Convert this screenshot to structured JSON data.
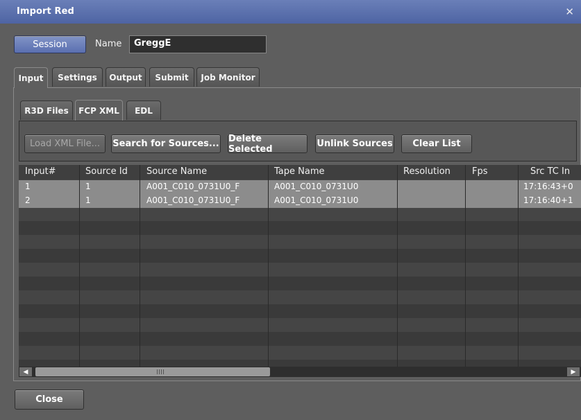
{
  "window": {
    "title": "Import Red",
    "close_glyph": "✕"
  },
  "session": {
    "button_label": "Session",
    "name_label": "Name",
    "name_value": "GreggE"
  },
  "tabs": [
    {
      "label": "Input",
      "active": true
    },
    {
      "label": "Settings",
      "active": false
    },
    {
      "label": "Output",
      "active": false
    },
    {
      "label": "Submit",
      "active": false
    },
    {
      "label": "Job Monitor",
      "active": false
    }
  ],
  "subtabs": [
    {
      "label": "R3D Files",
      "active": false
    },
    {
      "label": "FCP XML",
      "active": true
    },
    {
      "label": "EDL",
      "active": false
    }
  ],
  "toolbar": {
    "load_xml": "Load XML File...",
    "search_sources": "Search for Sources...",
    "delete_selected": "Delete Selected",
    "unlink_sources": "Unlink Sources",
    "clear_list": "Clear List"
  },
  "table": {
    "columns": [
      "Input#",
      "Source Id",
      "Source Name",
      "Tape Name",
      "Resolution",
      "Fps",
      "Src TC In"
    ],
    "rows": [
      [
        "1",
        "1",
        "A001_C010_0731U0_F",
        "A001_C010_0731U0",
        "",
        "",
        "17:16:43+0"
      ],
      [
        "2",
        "1",
        "A001_C010_0731U0_F",
        "A001_C010_0731U0",
        "",
        "",
        "17:16:40+1"
      ]
    ]
  },
  "footer": {
    "close_label": "Close"
  },
  "icons": {
    "scroll_left": "scroll-left-arrow-icon",
    "scroll_right": "scroll-right-arrow-icon"
  }
}
